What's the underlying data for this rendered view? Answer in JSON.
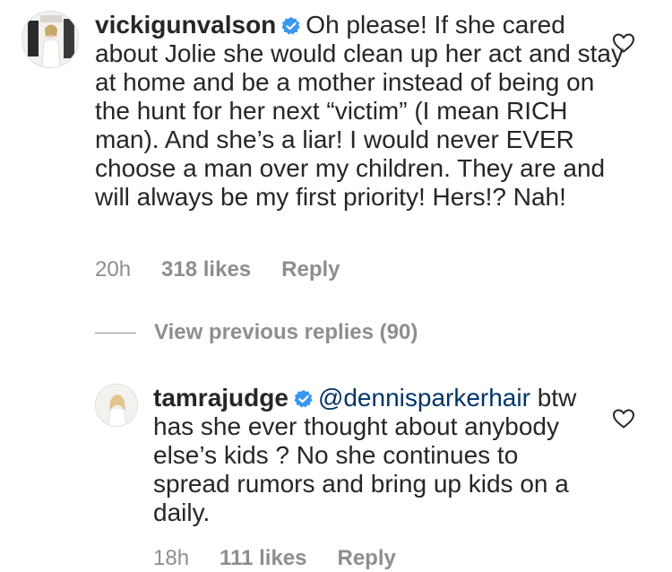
{
  "comments": [
    {
      "username": "vickigunvalson",
      "verified": true,
      "mention": "",
      "text": "Oh please!  If she cared about Jolie she would clean up her act and stay at home and be a mother instead of being on the hunt for her next “victim” (I mean RICH man). And she’s a liar!  I would never EVER choose a man over my children.  They are and will always be my first priority! Hers!? Nah!",
      "time": "20h",
      "likes": "318 likes",
      "reply_label": "Reply",
      "heart_icon": "heart-outline-icon"
    },
    {
      "username": "tamrajudge",
      "verified": true,
      "mention": "@dennisparkerhair",
      "text": "btw has she ever thought about anybody else’s kids ?  No she continues to spread rumors and bring up kids on a daily.",
      "time": "18h",
      "likes": "111 likes",
      "reply_label": "Reply",
      "heart_icon": "heart-outline-icon"
    }
  ],
  "view_previous_replies": "View previous replies (90)",
  "colors": {
    "text": "#262626",
    "meta": "#8e8e8e",
    "mention": "#003569",
    "verified_badge": "#3897f0"
  }
}
